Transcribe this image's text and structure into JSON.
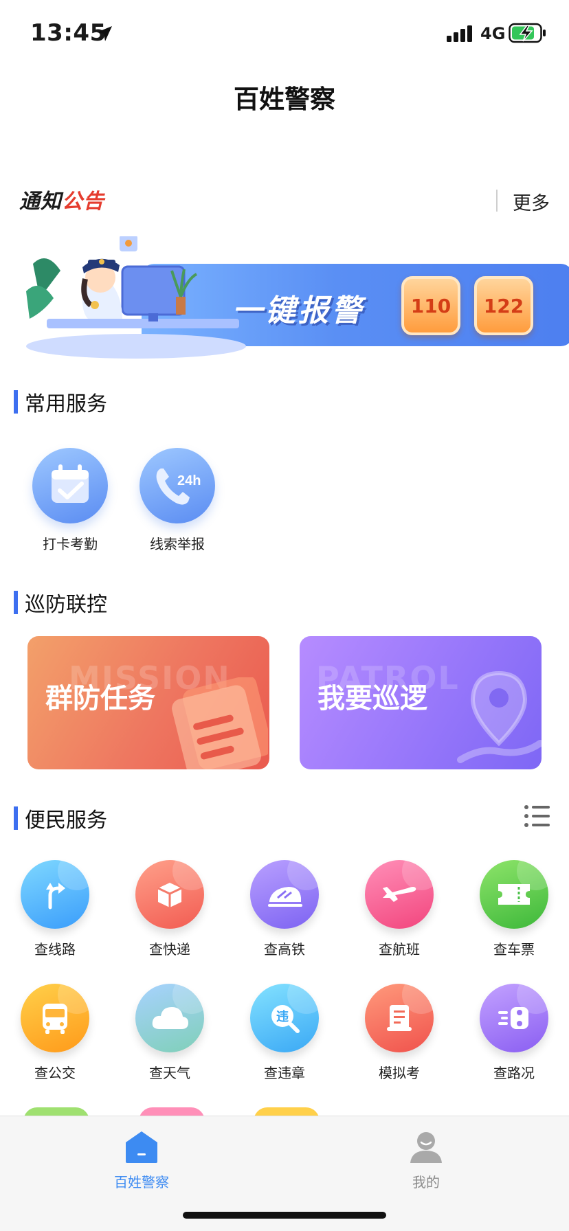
{
  "status_bar": {
    "time": "13:45",
    "network": "4G",
    "icons": [
      "location-arrow-icon",
      "signal-icon",
      "battery-charging-icon"
    ]
  },
  "header": {
    "title": "百姓警察"
  },
  "notice": {
    "logo_part1": "通知",
    "logo_part2": "公告",
    "more_label": "更多"
  },
  "banner": {
    "text": "一键报警",
    "buttons": [
      "110",
      "122"
    ]
  },
  "common_services": {
    "title": "常用服务",
    "items": [
      {
        "label": "打卡考勤",
        "icon": "calendar-check-icon"
      },
      {
        "label": "线索举报",
        "icon": "phone-24h-icon"
      }
    ]
  },
  "patrol": {
    "title": "巡防联控",
    "cards": [
      {
        "ghost": "MISSION",
        "label": "群防任务",
        "icon": "document-icon"
      },
      {
        "ghost": "PATROL",
        "label": "我要巡逻",
        "icon": "map-pin-icon"
      }
    ]
  },
  "convenience": {
    "title": "便民服务",
    "items": [
      {
        "label": "查线路",
        "icon": "route-arrow-icon"
      },
      {
        "label": "查快递",
        "icon": "package-icon"
      },
      {
        "label": "查高铁",
        "icon": "train-icon"
      },
      {
        "label": "查航班",
        "icon": "airplane-icon"
      },
      {
        "label": "查车票",
        "icon": "ticket-icon"
      },
      {
        "label": "查公交",
        "icon": "bus-icon"
      },
      {
        "label": "查天气",
        "icon": "cloud-icon"
      },
      {
        "label": "查违章",
        "icon": "violation-icon"
      },
      {
        "label": "模拟考",
        "icon": "exam-scroll-icon"
      },
      {
        "label": "查路况",
        "icon": "traffic-light-icon"
      }
    ]
  },
  "tab_bar": {
    "tabs": [
      {
        "label": "百姓警察",
        "icon": "home-icon",
        "active": true
      },
      {
        "label": "我的",
        "icon": "user-icon",
        "active": false
      }
    ]
  },
  "colors": {
    "primary": "#3d6ff0",
    "tab_active": "#3d8bf2",
    "notice_red": "#e53c2e"
  }
}
